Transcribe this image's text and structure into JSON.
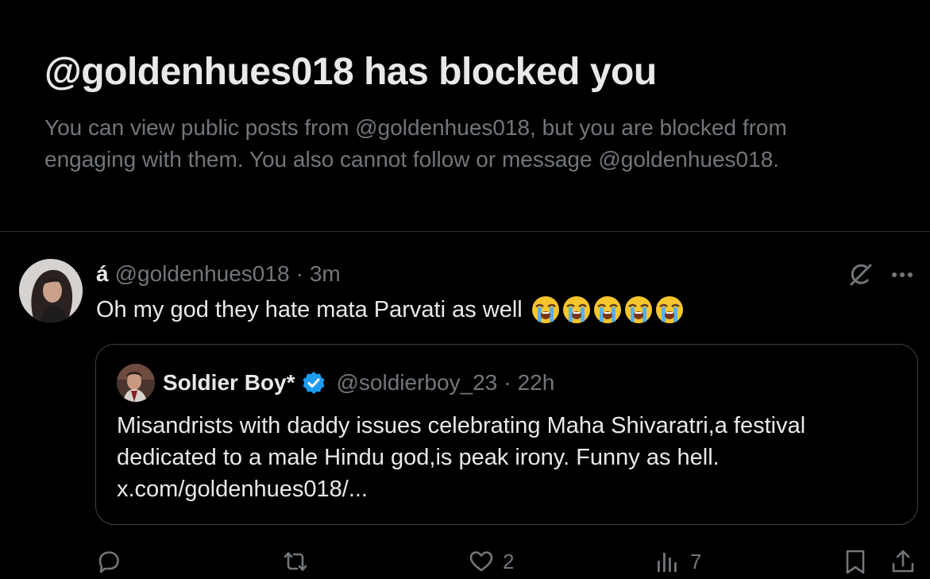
{
  "blocked": {
    "title": "@goldenhues018 has blocked you",
    "description_line1": "You can view public posts from @goldenhues018, but you are blocked from",
    "description_line2": "engaging with them. You also cannot follow or message @goldenhues018."
  },
  "post": {
    "author_name": "á",
    "author_handle": "@goldenhues018",
    "separator": "·",
    "time": "3m",
    "text": "Oh my god they hate mata Parvati as well",
    "emojis": [
      "loudly-crying-face",
      "loudly-crying-face",
      "loudly-crying-face",
      "loudly-crying-face",
      "loudly-crying-face"
    ]
  },
  "quote": {
    "author_name": "Soldier Boy*",
    "author_handle": "@soldierboy_23",
    "separator": "·",
    "time": "22h",
    "verified": true,
    "text_line1": "Misandrists with daddy issues celebrating Maha Shivaratri,a festival",
    "text_line2": "dedicated to a male Hindu god,is peak irony. Funny as hell.",
    "text_line3": "x.com/goldenhues018/..."
  },
  "actions": {
    "reply_icon": "reply-icon",
    "repost_icon": "repost-icon",
    "like_icon": "heart-icon",
    "like_count": "2",
    "views_icon": "views-icon",
    "views_count": "7",
    "bookmark_icon": "bookmark-icon",
    "share_icon": "share-icon"
  },
  "colors": {
    "background": "#000000",
    "text_primary": "#e7e9ea",
    "text_secondary": "#71767b",
    "border": "#2f3336",
    "verified_blue": "#1d9bf0"
  }
}
